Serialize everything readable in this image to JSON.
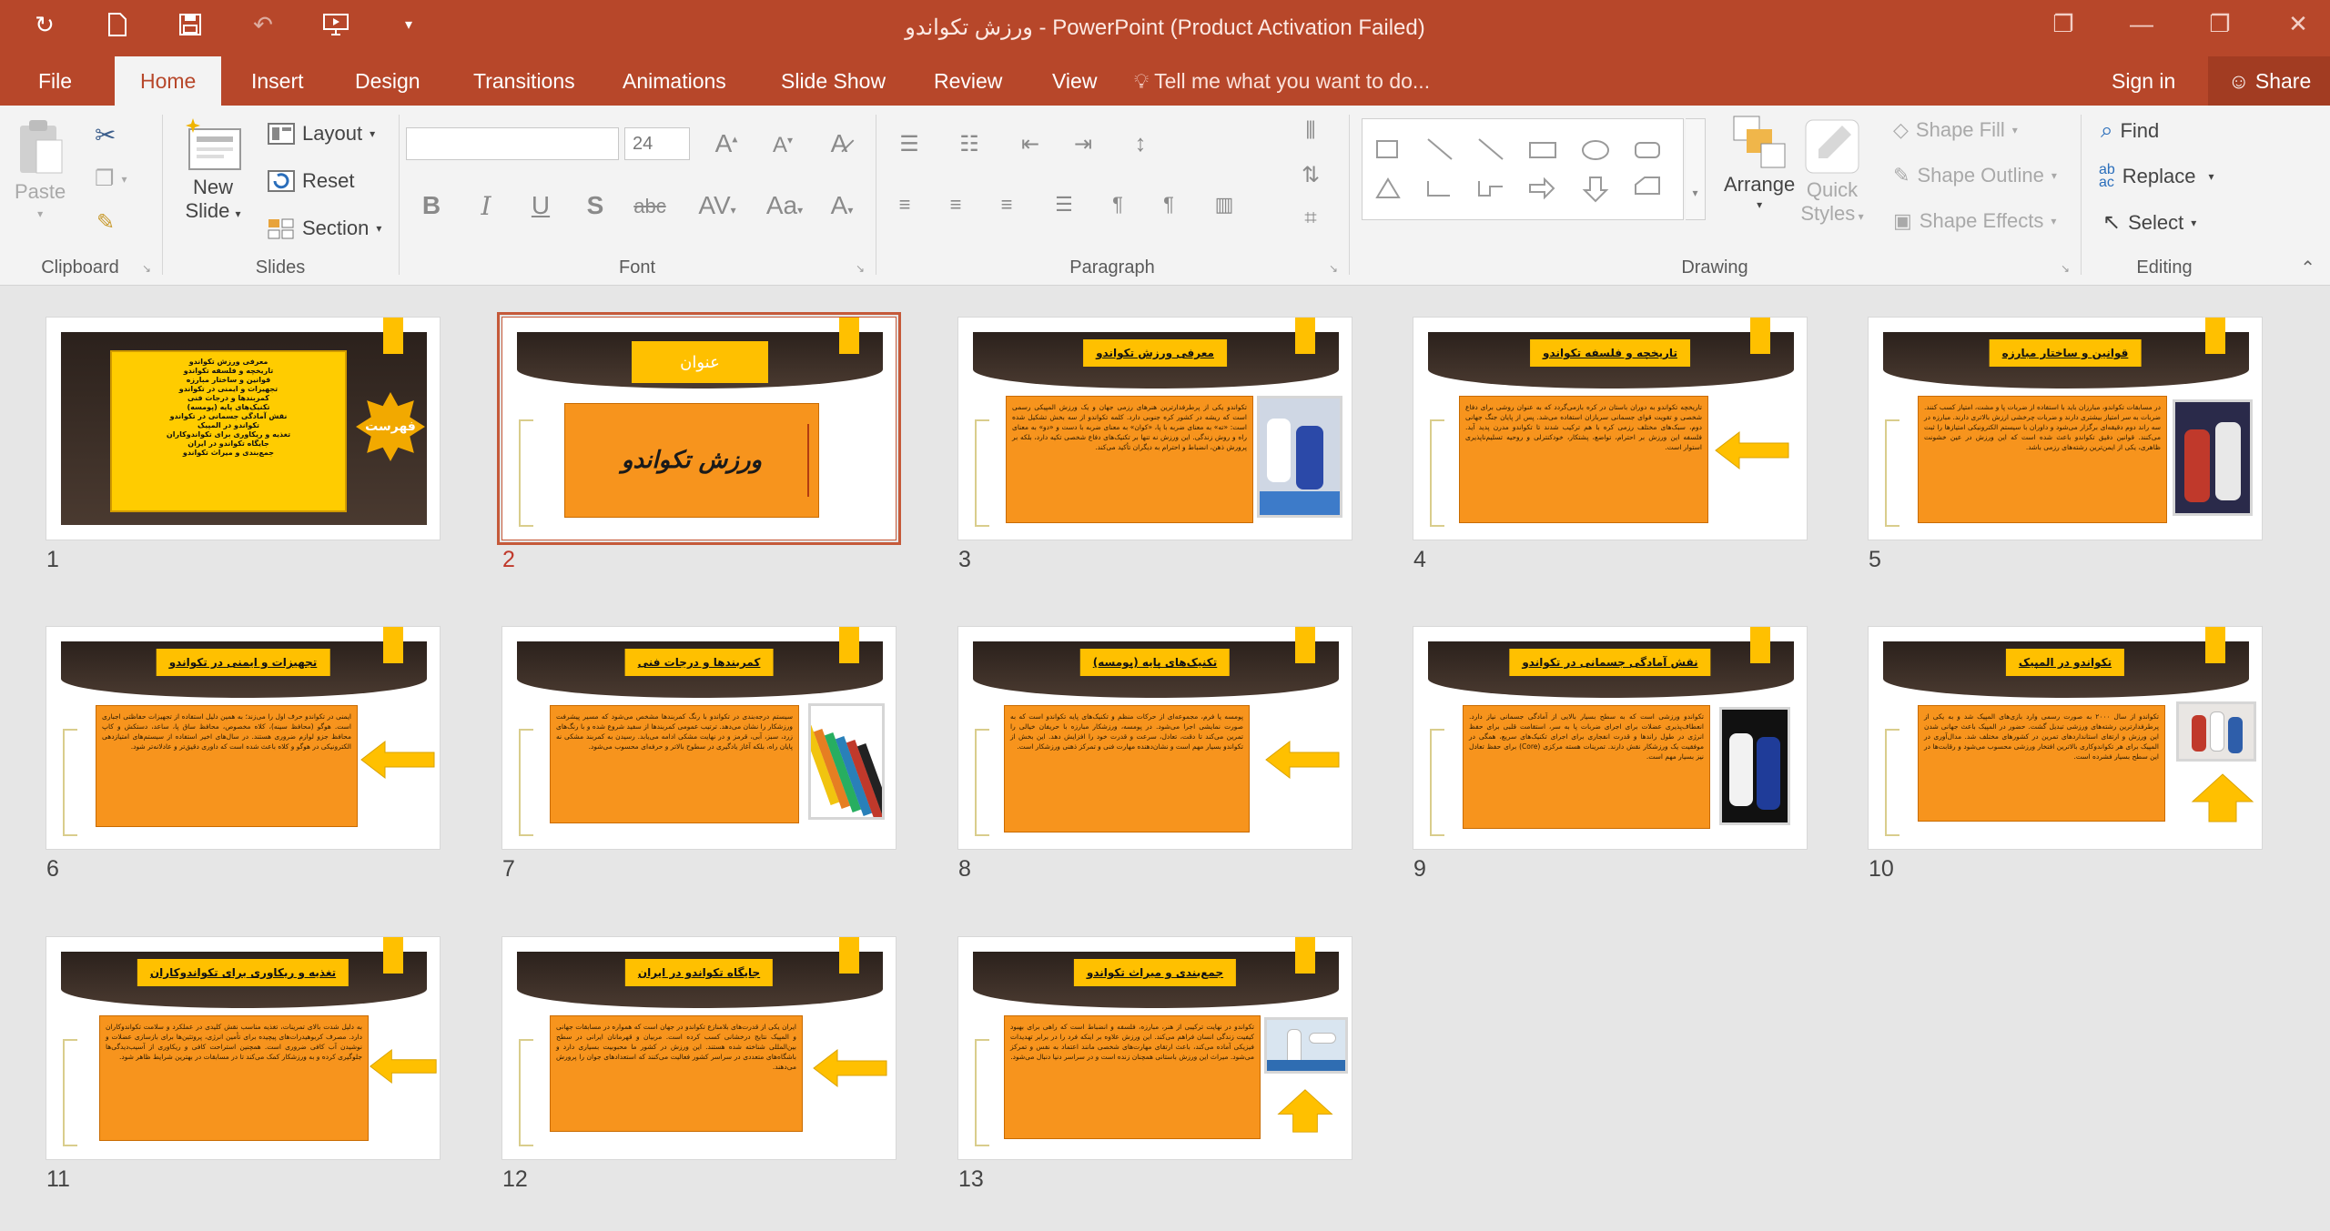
{
  "app": {
    "window_title": "ورزش تکواندو - PowerPoint (Product Activation Failed)"
  },
  "tabs": [
    "File",
    "Home",
    "Insert",
    "Design",
    "Transitions",
    "Animations",
    "Slide Show",
    "Review",
    "View"
  ],
  "active_tab": "Home",
  "tell_me": "Tell me what you want to do...",
  "sign_in": "Sign in",
  "share": "Share",
  "ribbon": {
    "clipboard": {
      "label": "Clipboard",
      "paste": "Paste"
    },
    "slides": {
      "label": "Slides",
      "new_slide_1": "New",
      "new_slide_2": "Slide",
      "layout": "Layout",
      "reset": "Reset",
      "section": "Section"
    },
    "font": {
      "label": "Font",
      "size": "24"
    },
    "paragraph": {
      "label": "Paragraph"
    },
    "drawing": {
      "label": "Drawing",
      "arrange": "Arrange",
      "quick_styles_1": "Quick",
      "quick_styles_2": "Styles",
      "shape_fill": "Shape Fill",
      "shape_outline": "Shape Outline",
      "shape_effects": "Shape Effects"
    },
    "editing": {
      "label": "Editing",
      "find": "Find",
      "replace": "Replace",
      "select": "Select"
    }
  },
  "slides": [
    {
      "num": "1",
      "title": "فهرست",
      "items": [
        "معرفی ورزش تکواندو",
        "تاریخچه و فلسفه تکواندو",
        "قوانین و ساختار مبارزه",
        "تجهیزات و ایمنی در تکواندو",
        "کمربندها و درجات فنی",
        "تکنیک‌های پایه (پومسه)",
        "نقش آمادگی جسمانی در تکواندو",
        "تکواندو در المپیک",
        "تغذیه و ریکاوری برای تکواندوکاران",
        "جایگاه تکواندو در ایران",
        "جمع‌بندی و میراث تکواندو"
      ]
    },
    {
      "num": "2",
      "title": "عنوان",
      "subtitle": "ورزش تکواندو"
    },
    {
      "num": "3",
      "title": "معرفی ورزش تکواندو",
      "text": "تکواندو یکی از پرطرفدارترین هنرهای رزمی جهان و یک ورزش المپیکی رسمی است که ریشه در کشور کره جنوبی دارد. کلمه تکواندو از سه بخش تشکیل شده است: «ته» به معنای ضربه با پا، «کوان» به معنای ضربه با دست و «دو» به معنای راه و روش زندگی. این ورزش نه تنها بر تکنیک‌های دفاع شخصی تکیه دارد، بلکه بر پرورش ذهن، انضباط و احترام به دیگران تأکید می‌کند."
    },
    {
      "num": "4",
      "title": "تاریخچه و فلسفه تکواندو",
      "text": "تاریخچه تکواندو به دوران باستان در کره بازمی‌گردد که به عنوان روشی برای دفاع شخصی و تقویت قوای جسمانی سربازان استفاده می‌شد. پس از پایان جنگ جهانی دوم، سبک‌های مختلف رزمی کره با هم ترکیب شدند تا تکواندو مدرن پدید آید. فلسفه این ورزش بر احترام، تواضع، پشتکار، خودکنترلی و روحیه تسلیم‌ناپذیری استوار است."
    },
    {
      "num": "5",
      "title": "قوانین و ساختار مبارزه",
      "text": "در مسابقات تکواندو، مبارزان باید با استفاده از ضربات پا و مشت، امتیاز کسب کنند. ضربات به سر امتیاز بیشتری دارند و ضربات چرخشی ارزش بالاتری دارند. مبارزه در سه راند دوم دقیقه‌ای برگزار می‌شود و داوران با سیستم الکترونیکی امتیازها را ثبت می‌کنند. قوانین دقیق تکواندو باعث شده است که این ورزش در عین خشونت ظاهری، یکی از ایمن‌ترین رشته‌های رزمی باشد."
    },
    {
      "num": "6",
      "title": "تجهیزات و ایمنی در تکواندو",
      "text": "ایمنی در تکواندو حرف اول را می‌زند؛ به همین دلیل استفاده از تجهیزات حفاظتی اجباری است. هوگو (محافظ سینه)، کلاه مخصوص، محافظ ساق پا، ساعد، دستکش و کاپ محافظ جزو لوازم ضروری هستند. در سال‌های اخیر استفاده از سیستم‌های امتیازدهی الکترونیکی در هوگو و کلاه باعث شده است که داوری دقیق‌تر و عادلانه‌تر شود."
    },
    {
      "num": "7",
      "title": "کمربندها و درجات فنی",
      "text": "سیستم درجه‌بندی در تکواندو با رنگ کمربندها مشخص می‌شود که مسیر پیشرفت ورزشکار را نشان می‌دهد. ترتیب عمومی کمربندها از سفید شروع شده و با رنگ‌های زرد، سبز، آبی، قرمز و در نهایت مشکی ادامه می‌یابد. رسیدن به کمربند مشکی نه پایان راه، بلکه آغاز یادگیری در سطوح بالاتر و حرفه‌ای محسوب می‌شود."
    },
    {
      "num": "8",
      "title": "تکنیک‌های پایه (پومسه)",
      "text": "پومسه یا فرم، مجموعه‌ای از حرکات منظم و تکنیک‌های پایه تکواندو است که به صورت نمایشی اجرا می‌شود. در پومسه، ورزشکار مبارزه با حریفان خیالی را تمرین می‌کند تا دقت، تعادل، سرعت و قدرت خود را افزایش دهد. این بخش از تکواندو بسیار مهم است و نشان‌دهنده مهارت فنی و تمرکز ذهنی ورزشکار است."
    },
    {
      "num": "9",
      "title": "نقش آمادگی جسمانی در تکواندو",
      "text": "تکواندو ورزشی است که به سطح بسیار بالایی از آمادگی جسمانی نیاز دارد. انعطاف‌پذیری عضلات برای اجرای ضربات پا به سر، استقامت قلبی برای حفظ انرژی در طول راندها و قدرت انفجاری برای اجرای تکنیک‌های سریع، همگی در موفقیت یک ورزشکار نقش دارند. تمرینات هسته مرکزی (Core) برای حفظ تعادل نیز بسیار مهم است."
    },
    {
      "num": "10",
      "title": "تکواندو در المپیک",
      "text": "تکواندو از سال ۲۰۰۰ به صورت رسمی وارد بازی‌های المپیک شد و به یکی از پرطرفدارترین رشته‌های ورزشی تبدیل گشت. حضور در المپیک باعث جهانی شدن این ورزش و ارتقای استانداردهای تمرین در کشورهای مختلف شد. مدال‌آوری در المپیک برای هر تکواندوکاری بالاترین افتخار ورزشی محسوب می‌شود و رقابت‌ها در این سطح بسیار فشرده است."
    },
    {
      "num": "11",
      "title": "تغذیه و ریکاوری برای تکواندوکاران",
      "text": "به دلیل شدت بالای تمرینات، تغذیه مناسب نقش کلیدی در عملکرد و سلامت تکواندوکاران دارد. مصرف کربوهیدرات‌های پیچیده برای تأمین انرژی، پروتئین‌ها برای بازسازی عضلات و نوشیدن آب کافی ضروری است. همچنین استراحت کافی و ریکاوری از آسیب‌دیدگی‌ها جلوگیری کرده و به ورزشکار کمک می‌کند تا در مسابقات در بهترین شرایط ظاهر شود."
    },
    {
      "num": "12",
      "title": "جایگاه تکواندو در ایران",
      "text": "ایران یکی از قدرت‌های بلامنازع تکواندو در جهان است که همواره در مسابقات جهانی و المپیک نتایج درخشانی کسب کرده است. مربیان و قهرمانان ایرانی در سطح بین‌المللی شناخته شده هستند. این ورزش در کشور ما محبوبیت بسیاری دارد و باشگاه‌های متعددی در سراسر کشور فعالیت می‌کنند که استعدادهای جوان را پرورش می‌دهند."
    },
    {
      "num": "13",
      "title": "جمع‌بندی و میراث تکواندو",
      "text": "تکواندو در نهایت ترکیبی از هنر، مبارزه، فلسفه و انضباط است که راهی برای بهبود کیفیت زندگی انسان فراهم می‌کند. این ورزش علاوه بر اینکه فرد را در برابر تهدیدات فیزیکی آماده می‌کند، باعث ارتقای مهارت‌های شخصی مانند اعتماد به نفس و تمرکز می‌شود. میراث این ورزش باستانی همچنان زنده است و در سراسر دنیا دنبال می‌شود."
    }
  ]
}
